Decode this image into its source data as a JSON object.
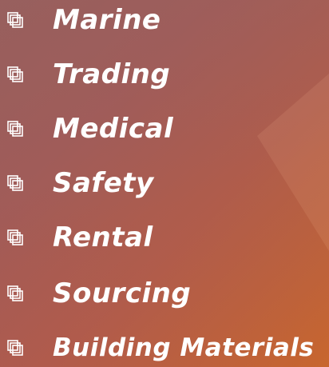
{
  "list": {
    "items": [
      {
        "label": "Marine",
        "icon": "layered-squares-icon"
      },
      {
        "label": "Trading",
        "icon": "layered-squares-icon"
      },
      {
        "label": "Medical",
        "icon": "layered-squares-icon"
      },
      {
        "label": "Safety",
        "icon": "layered-squares-icon"
      },
      {
        "label": "Rental",
        "icon": "layered-squares-icon"
      },
      {
        "label": "Sourcing",
        "icon": "layered-squares-icon"
      },
      {
        "label": "Building Materials",
        "icon": "layered-squares-icon"
      }
    ]
  },
  "colors": {
    "text": "#ffffff",
    "background_start": "#9a5a5c",
    "background_end": "#c8662e"
  }
}
